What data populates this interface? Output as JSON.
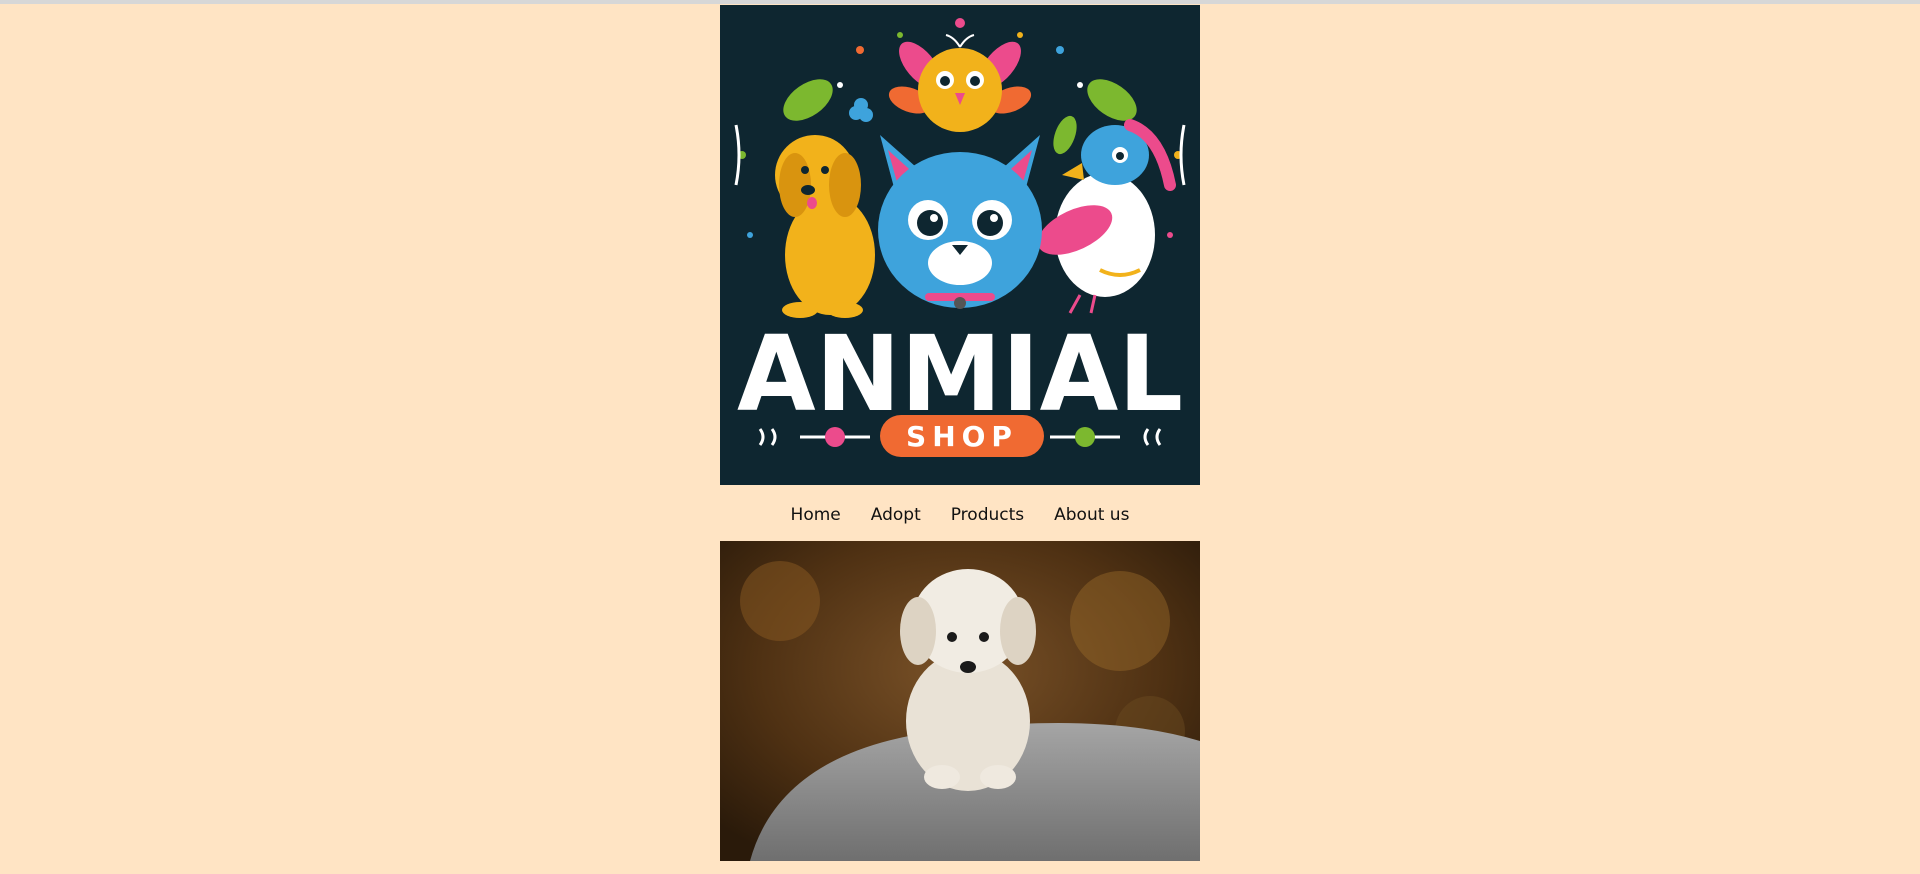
{
  "logo": {
    "word": "ANMIAL",
    "badge": "SHOP",
    "colors": {
      "background": "#0e2630",
      "cat": "#3ea3dc",
      "dog": "#f2b21b",
      "pink": "#ec4b8c",
      "orange": "#f06a32",
      "green": "#7cb82f"
    }
  },
  "nav": {
    "items": [
      {
        "label": "Home"
      },
      {
        "label": "Adopt"
      },
      {
        "label": "Products"
      },
      {
        "label": "About us"
      }
    ]
  },
  "hero": {
    "subject": "white-puppy-on-rock",
    "colors": {
      "bg": "#5a3a18",
      "rock": "#8d8d8d",
      "fur": "#eee8df"
    }
  }
}
